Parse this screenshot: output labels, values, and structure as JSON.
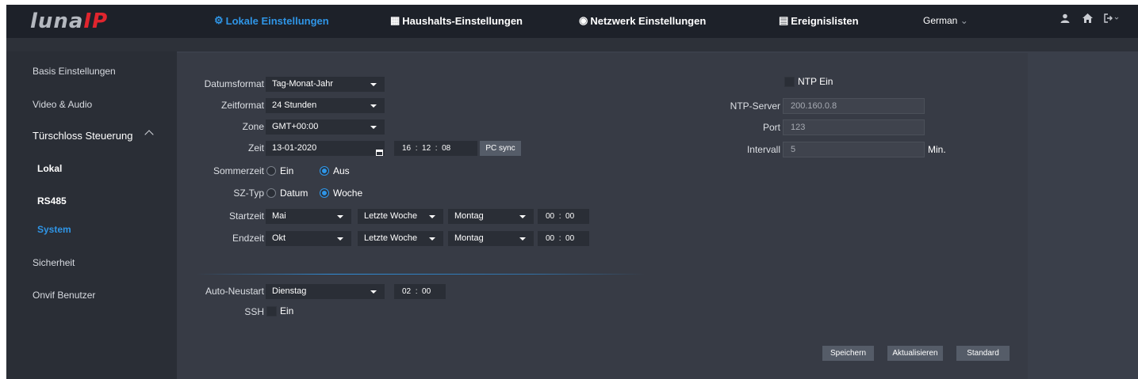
{
  "brand": {
    "logo_main": "luna",
    "logo_accent": "IP"
  },
  "nav": {
    "local": "Lokale Einstellungen",
    "household": "Haushalts-Einstellungen",
    "network": "Netzwerk Einstellungen",
    "events": "Ereignislisten",
    "language": "German",
    "language_caret": "⌄"
  },
  "colors": {
    "accent": "#2f95e6",
    "logo_red": "#e1252e",
    "topbar": "#1d2129",
    "panel": "#373b45"
  },
  "sidebar": {
    "items": [
      {
        "label": "Basis Einstellungen"
      },
      {
        "label": "Video & Audio"
      },
      {
        "label": "Türschloss Steuerung"
      },
      {
        "label": "Lokal"
      },
      {
        "label": "RS485"
      },
      {
        "label": "System",
        "active": true
      },
      {
        "label": "Sicherheit"
      },
      {
        "label": "Onvif Benutzer"
      }
    ]
  },
  "form": {
    "date_format": {
      "label": "Datumsformat",
      "value": "Tag-Monat-Jahr"
    },
    "time_format": {
      "label": "Zeitformat",
      "value": "24 Stunden"
    },
    "zone": {
      "label": "Zone",
      "value": "GMT+00:00"
    },
    "time": {
      "label": "Zeit",
      "date": "13-01-2020",
      "hh": "16",
      "mm": "12",
      "ss": "08",
      "sep": ":",
      "pc_sync": "PC sync"
    },
    "dst": {
      "label": "Sommerzeit",
      "opt_on": "Ein",
      "opt_off": "Aus",
      "selected": "Aus"
    },
    "dst_type": {
      "label": "SZ-Typ",
      "opt_date": "Datum",
      "opt_week": "Woche",
      "selected": "Woche"
    },
    "start": {
      "label": "Startzeit",
      "month": "Mai",
      "week": "Letzte Woche",
      "day": "Montag",
      "hh": "00",
      "mm": "00"
    },
    "end": {
      "label": "Endzeit",
      "month": "Okt",
      "week": "Letzte Woche",
      "day": "Montag",
      "hh": "00",
      "mm": "00"
    },
    "auto_restart": {
      "label": "Auto-Neustart",
      "day": "Dienstag",
      "hh": "02",
      "mm": "00"
    },
    "ssh": {
      "label": "SSH",
      "opt": "Ein"
    }
  },
  "ntp": {
    "enable_label": "NTP Ein",
    "server_label": "NTP-Server",
    "server_value": "200.160.0.8",
    "port_label": "Port",
    "port_value": "123",
    "interval_label": "Intervall",
    "interval_value": "5",
    "interval_unit": "Min."
  },
  "buttons": {
    "save": "Speichern",
    "refresh": "Aktualisieren",
    "default": "Standard"
  },
  "icons": {
    "local": "gear-icon",
    "household": "building-icon",
    "network": "globe-icon",
    "events": "list-icon",
    "user": "user-icon",
    "home": "home-icon",
    "logout": "logout-icon"
  }
}
